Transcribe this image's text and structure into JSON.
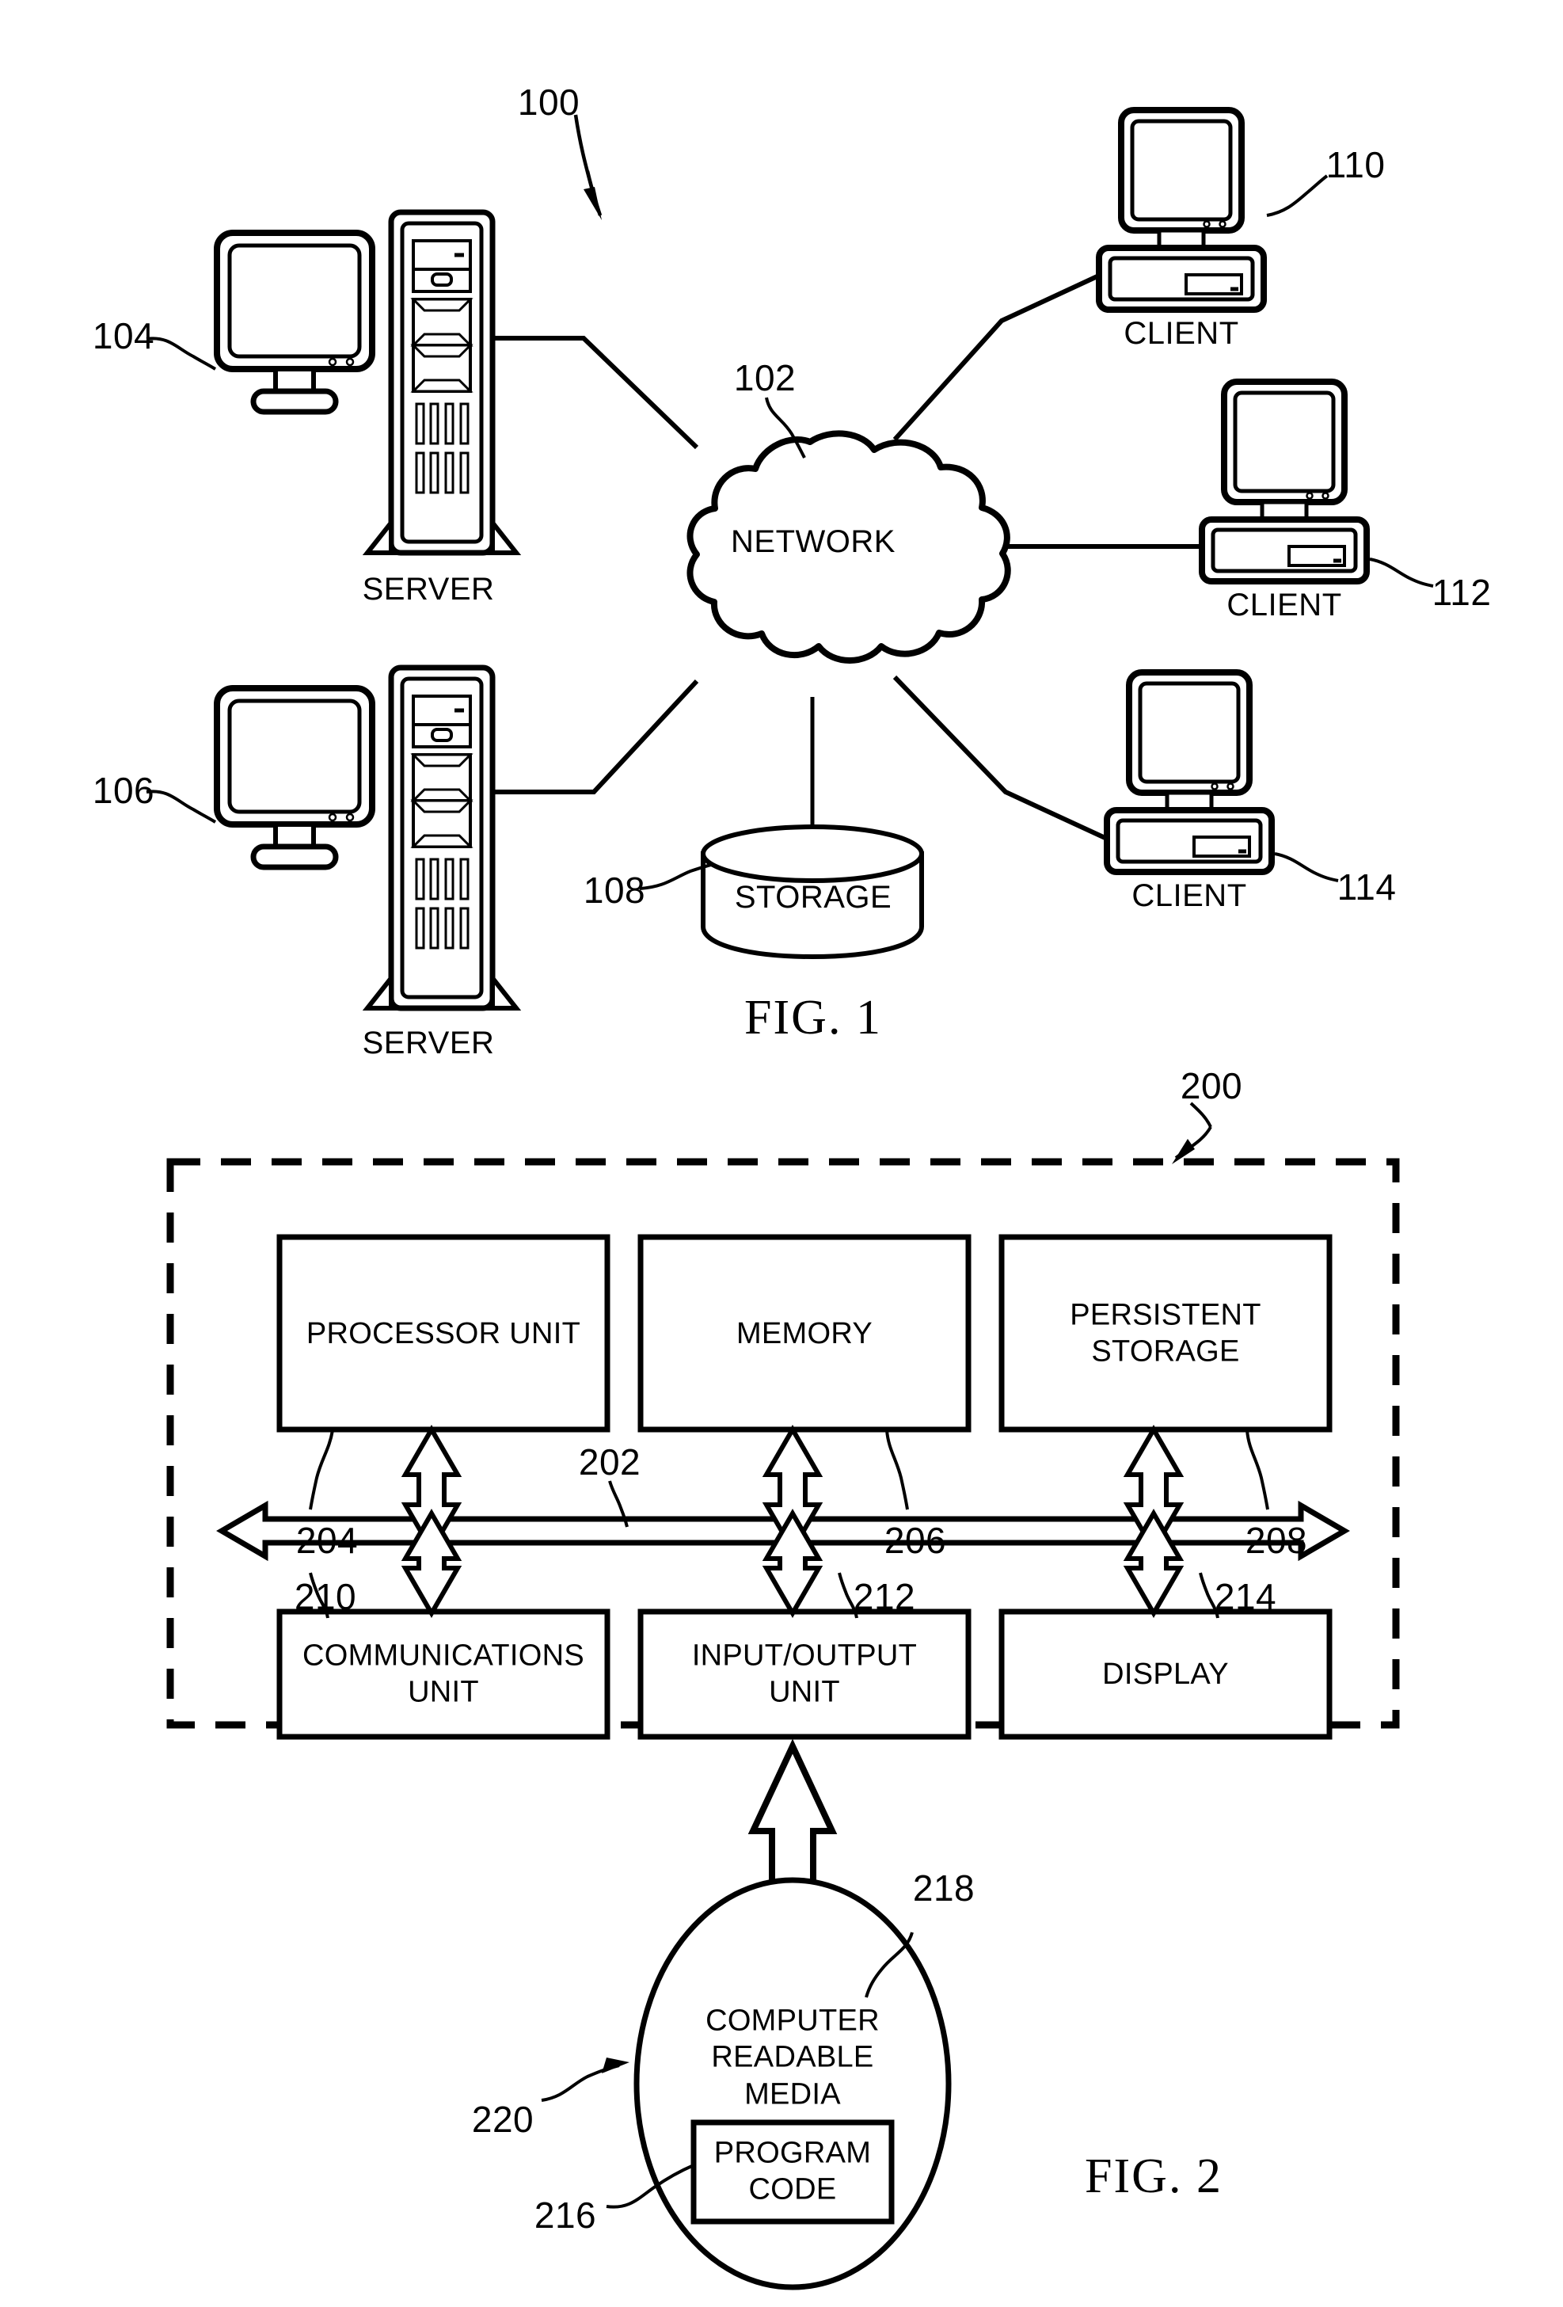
{
  "document": {
    "type": "patent-drawing-sheet",
    "figures": [
      "FIG. 1",
      "FIG. 2"
    ]
  },
  "figure1": {
    "caption": "FIG. 1",
    "system_ref": "100",
    "network": {
      "label": "NETWORK",
      "ref": "102"
    },
    "storage": {
      "label": "STORAGE",
      "ref": "108"
    },
    "servers": [
      {
        "label": "SERVER",
        "ref": "104",
        "icon": "desktop-monitor-and-tower-icon"
      },
      {
        "label": "SERVER",
        "ref": "106",
        "icon": "desktop-monitor-and-tower-icon"
      }
    ],
    "clients": [
      {
        "label": "CLIENT",
        "ref": "110",
        "icon": "desktop-computer-icon"
      },
      {
        "label": "CLIENT",
        "ref": "112",
        "icon": "desktop-computer-icon"
      },
      {
        "label": "CLIENT",
        "ref": "114",
        "icon": "desktop-computer-icon"
      }
    ]
  },
  "figure2": {
    "caption": "FIG. 2",
    "system_ref": "200",
    "data_processing_system_ref": "200",
    "bus_ref": "202",
    "boxes_top": [
      {
        "label": "PROCESSOR UNIT",
        "ref": "204"
      },
      {
        "label": "MEMORY",
        "ref": "206"
      },
      {
        "label": "PERSISTENT\nSTORAGE",
        "ref": "208"
      }
    ],
    "boxes_bottom": [
      {
        "label": "COMMUNICATIONS\nUNIT",
        "ref": "210"
      },
      {
        "label": "INPUT/OUTPUT\nUNIT",
        "ref": "212"
      },
      {
        "label": "DISPLAY",
        "ref": "214"
      }
    ],
    "media": {
      "label": "COMPUTER\nREADABLE\nMEDIA",
      "ref": "218",
      "program_code": {
        "label": "PROGRAM\nCODE",
        "ref": "216"
      },
      "product_ref": "220"
    }
  },
  "colors": {
    "ink": "#000000",
    "paper": "#ffffff"
  }
}
